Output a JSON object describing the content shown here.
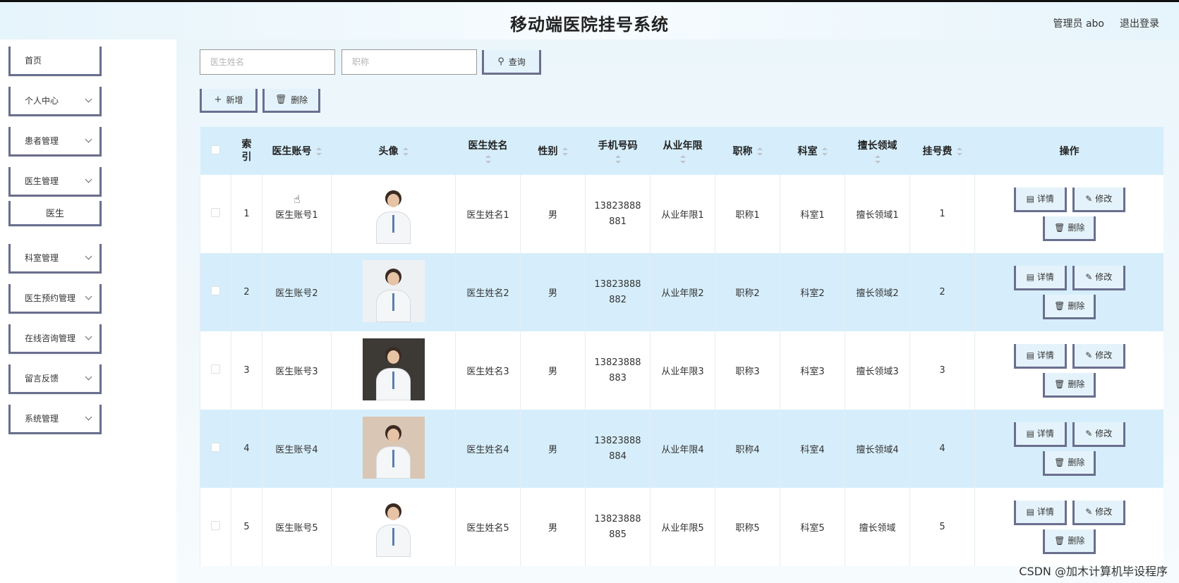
{
  "header": {
    "title": "移动端医院挂号系统",
    "user": "管理员 abo",
    "logout": "退出登录"
  },
  "sidebar": {
    "items": [
      {
        "label": "首页",
        "has_arrow": false
      },
      {
        "label": "个人中心",
        "has_arrow": true
      },
      {
        "label": "患者管理",
        "has_arrow": true
      },
      {
        "label": "医生管理",
        "has_arrow": true
      },
      {
        "label": "医生",
        "has_arrow": false,
        "sub": true
      },
      {
        "label": "科室管理",
        "has_arrow": true
      },
      {
        "label": "医生预约管理",
        "has_arrow": true
      },
      {
        "label": "在线咨询管理",
        "has_arrow": true
      },
      {
        "label": "留言反馈",
        "has_arrow": true
      },
      {
        "label": "系统管理",
        "has_arrow": true
      }
    ]
  },
  "search": {
    "name_placeholder": "医生姓名",
    "title_placeholder": "职称",
    "query_label": "查询"
  },
  "actions": {
    "add_label": "新增",
    "delete_label": "删除"
  },
  "table": {
    "headers": [
      "索引",
      "医生账号",
      "头像",
      "医生姓名",
      "性别",
      "手机号码",
      "从业年限",
      "职称",
      "科室",
      "擅长领域",
      "挂号费",
      "操作"
    ],
    "op_labels": {
      "detail": "详情",
      "edit": "修改",
      "delete": "删除"
    },
    "rows": [
      {
        "index": "1",
        "account": "医生账号1",
        "name": "医生姓名1",
        "gender": "男",
        "phone_a": "13823888",
        "phone_b": "881",
        "years": "从业年限1",
        "title": "职称1",
        "dept": "科室1",
        "field": "擅长领域1",
        "fee": "1"
      },
      {
        "index": "2",
        "account": "医生账号2",
        "name": "医生姓名2",
        "gender": "男",
        "phone_a": "13823888",
        "phone_b": "882",
        "years": "从业年限2",
        "title": "职称2",
        "dept": "科室2",
        "field": "擅长领域2",
        "fee": "2"
      },
      {
        "index": "3",
        "account": "医生账号3",
        "name": "医生姓名3",
        "gender": "男",
        "phone_a": "13823888",
        "phone_b": "883",
        "years": "从业年限3",
        "title": "职称3",
        "dept": "科室3",
        "field": "擅长领域3",
        "fee": "3"
      },
      {
        "index": "4",
        "account": "医生账号4",
        "name": "医生姓名4",
        "gender": "男",
        "phone_a": "13823888",
        "phone_b": "884",
        "years": "从业年限4",
        "title": "职称4",
        "dept": "科室4",
        "field": "擅长领域4",
        "fee": "4"
      },
      {
        "index": "5",
        "account": "医生账号5",
        "name": "医生姓名5",
        "gender": "男",
        "phone_a": "13823888",
        "phone_b": "885",
        "years": "从业年限5",
        "title": "职称5",
        "dept": "科室5",
        "field": "擅长领域",
        "fee": "5"
      }
    ]
  },
  "watermark": "CSDN @加木计算机毕设程序",
  "icons": {
    "search": "search-icon",
    "add": "plus-icon",
    "delete": "trash-icon",
    "detail": "document-icon",
    "edit": "pencil-icon",
    "cursor": "hand-cursor-icon"
  },
  "colors": {
    "header_bg": "#d6eefb",
    "row_alt": "#d6eefb",
    "button_border": "#6a6f8e",
    "button_bg": "#e4f3fb"
  }
}
